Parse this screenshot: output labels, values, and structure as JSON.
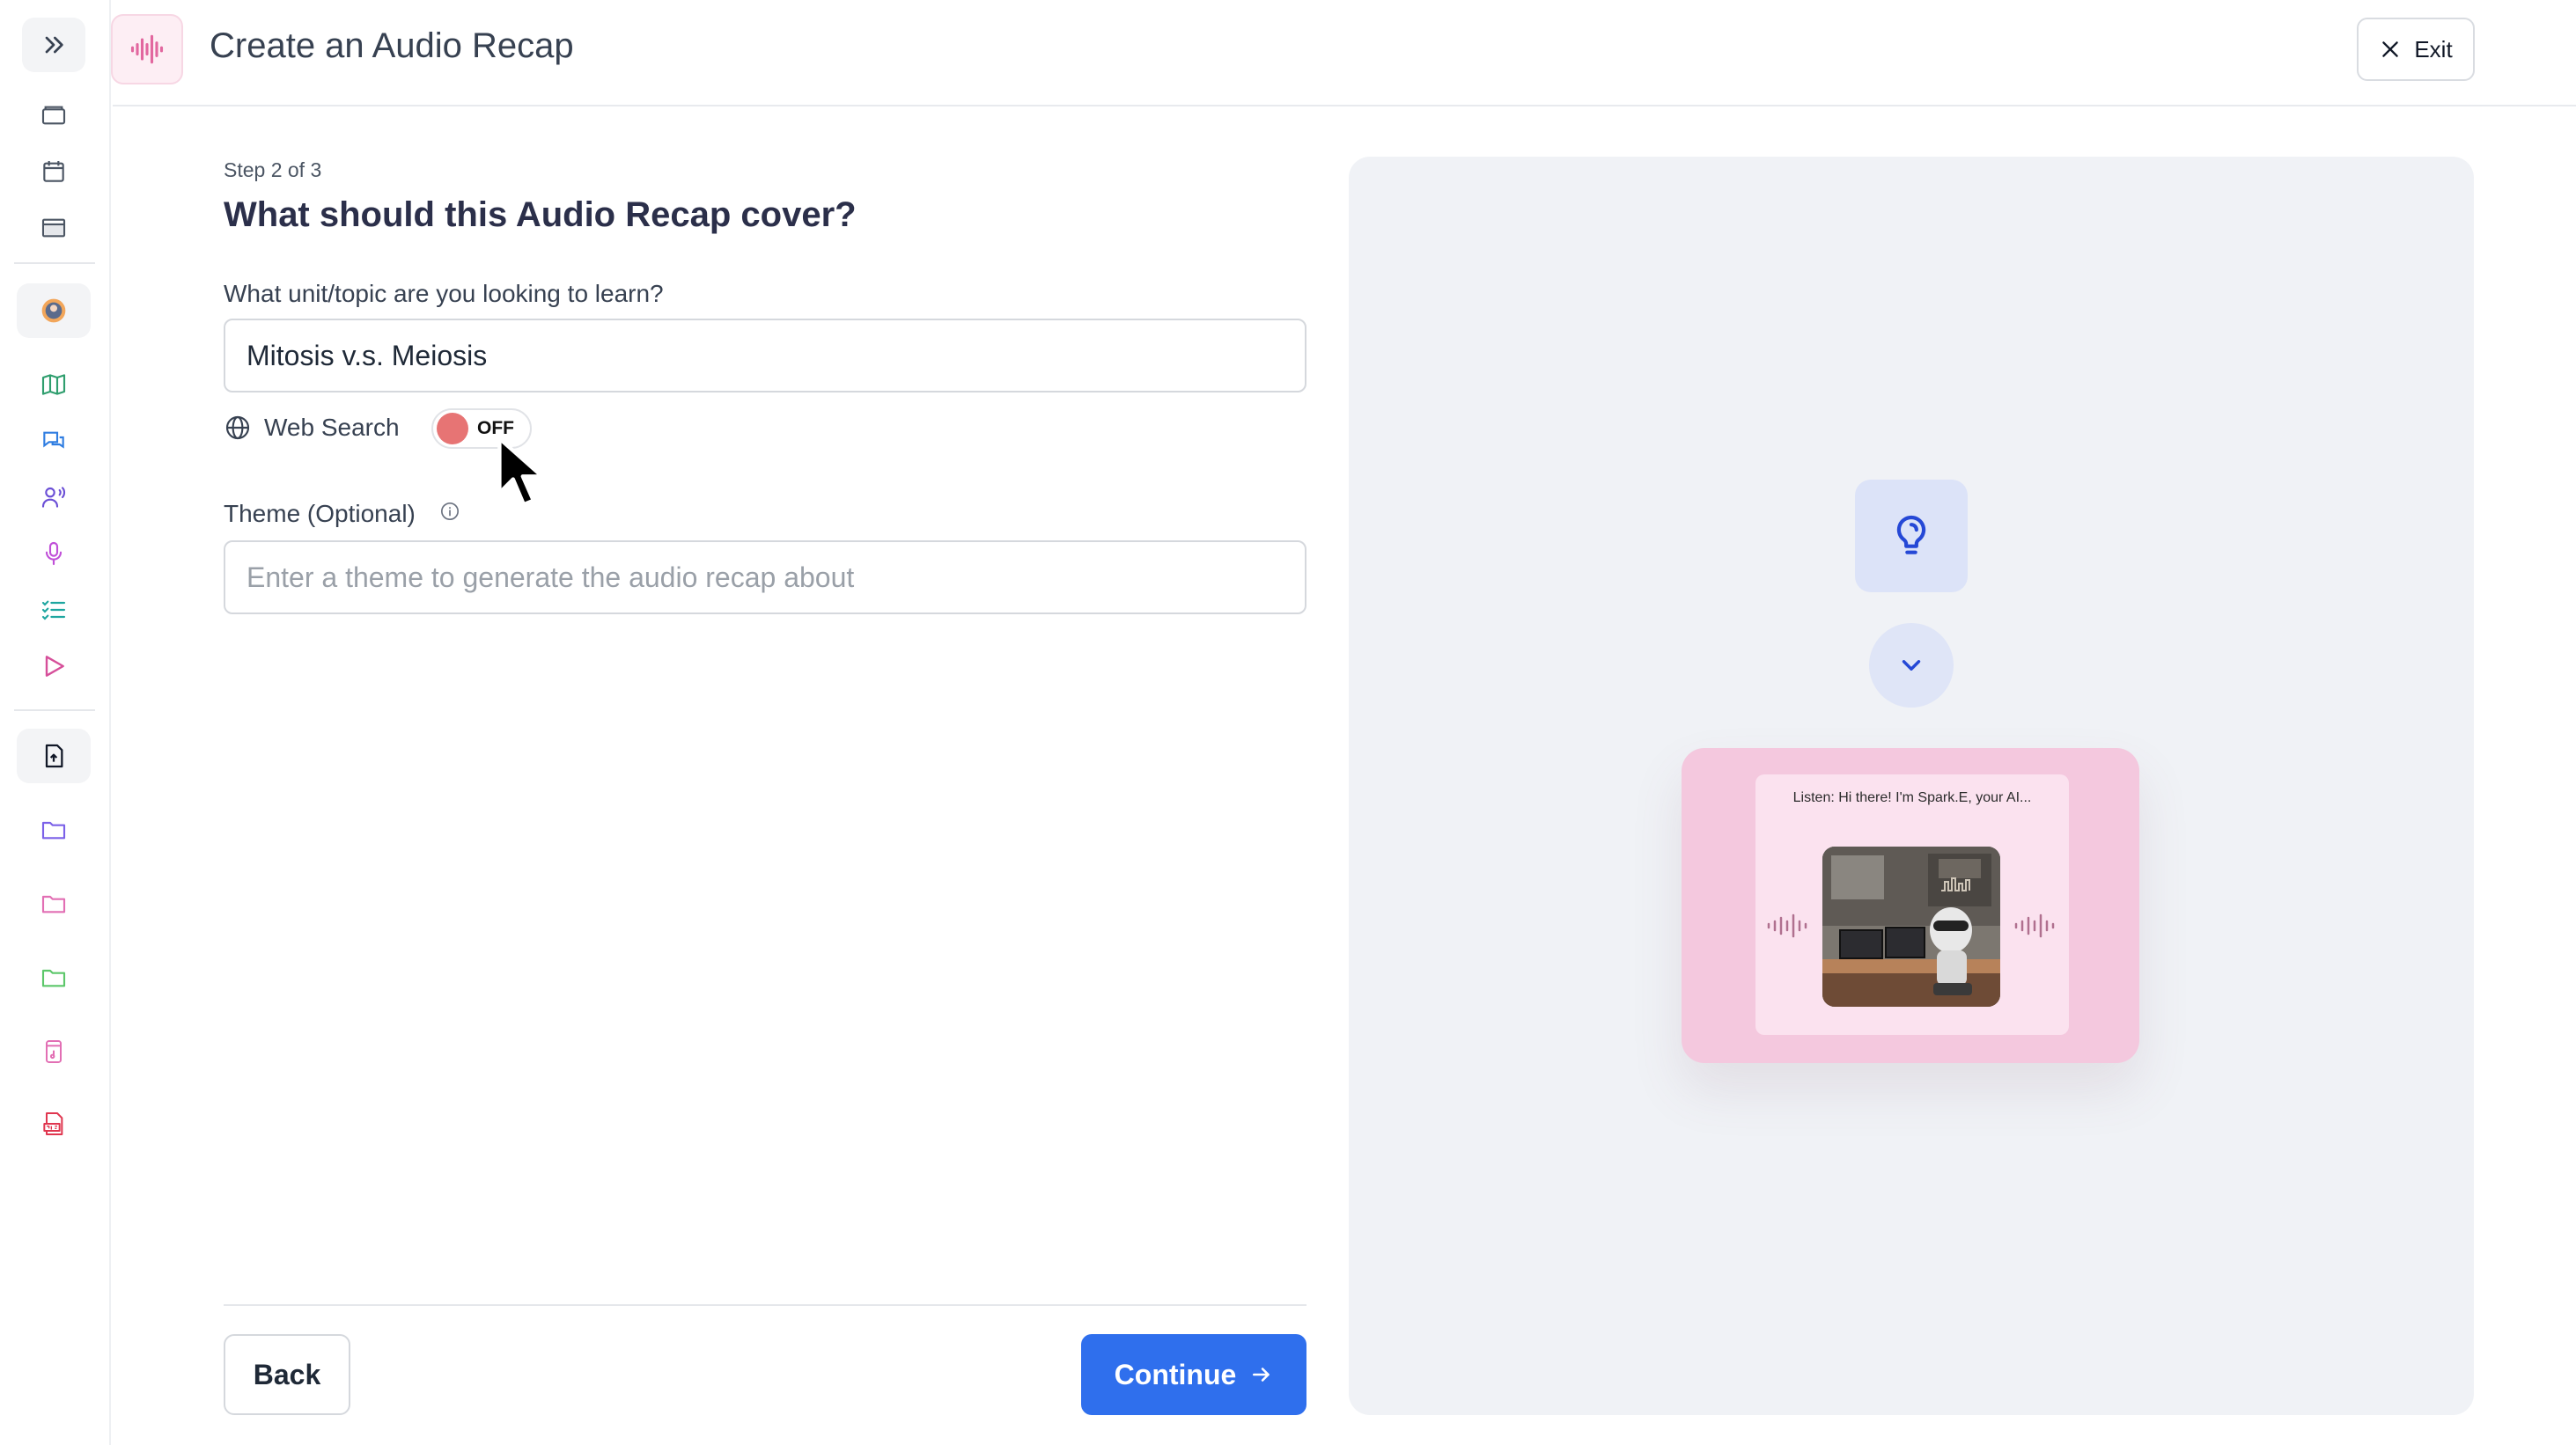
{
  "header": {
    "title": "Create an Audio Recap",
    "exit_label": "Exit"
  },
  "sidebar": {
    "items": [
      {
        "icon": "chevrons-right-icon"
      },
      {
        "icon": "folders-icon"
      },
      {
        "icon": "calendar-icon"
      },
      {
        "icon": "browser-window-icon"
      },
      {
        "icon": "avatar-icon"
      },
      {
        "icon": "map-icon",
        "color": "#2f9e6e"
      },
      {
        "icon": "chat-bubbles-icon",
        "color": "#2f7de1"
      },
      {
        "icon": "speaking-person-icon",
        "color": "#6b4fd6"
      },
      {
        "icon": "microphone-icon",
        "color": "#c04fd8"
      },
      {
        "icon": "checklist-icon",
        "color": "#1ea6a0"
      },
      {
        "icon": "play-icon",
        "color": "#d64f9a"
      },
      {
        "icon": "file-upload-icon"
      },
      {
        "icon": "folder-icon",
        "color": "#7b61e8"
      },
      {
        "icon": "folder-icon",
        "color": "#e26fb4"
      },
      {
        "icon": "folder-icon",
        "color": "#5cc76a"
      },
      {
        "icon": "audio-file-icon",
        "color": "#e26fb4"
      },
      {
        "icon": "pdf-file-icon",
        "color": "#e0364f"
      }
    ]
  },
  "form": {
    "step": "Step 2 of 3",
    "question": "What should this Audio Recap cover?",
    "topic_label": "What unit/topic are you looking to learn?",
    "topic_value": "Mitosis v.s. Meiosis",
    "web_search_label": "Web Search",
    "web_search_state": "OFF",
    "theme_label": "Theme (Optional)",
    "theme_placeholder": "Enter a theme to generate the audio recap about",
    "back_label": "Back",
    "continue_label": "Continue"
  },
  "preview": {
    "caption": "Listen: Hi there! I'm Spark.E, your AI..."
  },
  "colors": {
    "accent": "#2f6fed",
    "toggle_off": "#e77474",
    "preview_bg": "#f0f2f6",
    "card_pink": "#f4c8de"
  }
}
